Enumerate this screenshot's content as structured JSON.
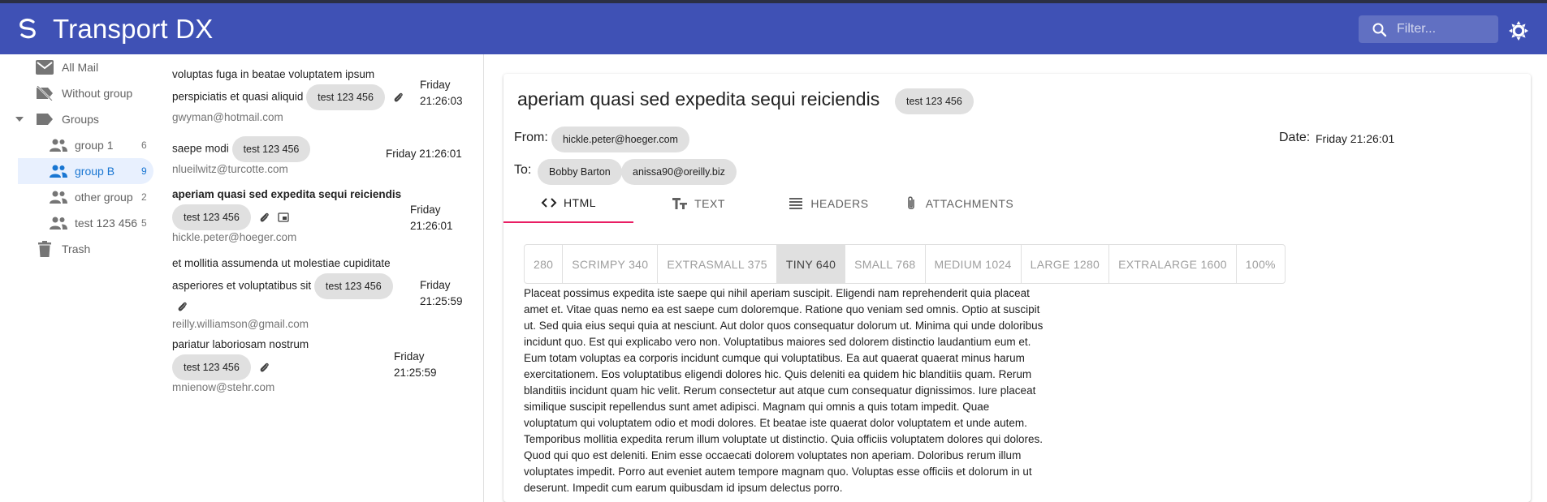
{
  "app": {
    "title": "Transport DX"
  },
  "search": {
    "placeholder": "Filter..."
  },
  "sidebar": {
    "items": [
      {
        "label": "All Mail",
        "count": ""
      },
      {
        "label": "Without group",
        "count": ""
      },
      {
        "label": "Groups",
        "count": ""
      },
      {
        "label": "group 1",
        "count": "6"
      },
      {
        "label": "group B",
        "count": "9"
      },
      {
        "label": "other group",
        "count": "2"
      },
      {
        "label": "test 123 456",
        "count": "5"
      },
      {
        "label": "Trash",
        "count": ""
      }
    ]
  },
  "messages": [
    {
      "subject": "voluptas fuga in beatae voluptatem ipsum perspiciatis et quasi aliquid",
      "chip": "test 123 456",
      "from": "gwyman@hotmail.com",
      "date_day": "Friday",
      "date_time": "21:26:03"
    },
    {
      "subject": "saepe modi",
      "chip": "test 123 456",
      "from": "nlueilwitz@turcotte.com",
      "date": "Friday 21:26:01"
    },
    {
      "subject": "aperiam quasi sed expedita sequi reiciendis",
      "chip": "test 123 456",
      "from": "hickle.peter@hoeger.com",
      "date_day": "Friday",
      "date_time": "21:26:01"
    },
    {
      "subject_line1": "et mollitia assumenda ut molestiae cupiditate",
      "subject_line2": "asperiores et voluptatibus sit",
      "chip": "test 123 456",
      "from": "reilly.williamson@gmail.com",
      "date_day": "Friday",
      "date_time": "21:25:59"
    },
    {
      "subject": "pariatur laboriosam nostrum",
      "chip": "test 123 456",
      "from": "mnienow@stehr.com",
      "date_day": "Friday",
      "date_time": "21:25:59"
    }
  ],
  "detail": {
    "subject": "aperiam quasi sed expedita sequi reiciendis",
    "chip": "test 123 456",
    "from_label": "From:",
    "from": "hickle.peter@hoeger.com",
    "date_label": "Date:",
    "date": "Friday 21:26:01",
    "to_label": "To:",
    "to": [
      "Bobby Barton",
      "anissa90@oreilly.biz"
    ],
    "tabs": [
      "HTML",
      "TEXT",
      "HEADERS",
      "ATTACHMENTS"
    ],
    "sizes": [
      "280",
      "SCRIMPY 340",
      "EXTRASMALL 375",
      "TINY 640",
      "SMALL 768",
      "MEDIUM 1024",
      "LARGE 1280",
      "EXTRALARGE 1600",
      "100%"
    ],
    "active_size": "TINY 640",
    "body": "Placeat possimus expedita iste saepe qui nihil aperiam suscipit. Eligendi nam reprehenderit quia placeat amet et. Vitae quas nemo ea est saepe cum doloremque. Ratione quo veniam sed omnis. Optio at suscipit ut. Sed quia eius sequi quia at nesciunt. Aut dolor quos consequatur dolorum ut. Minima qui unde doloribus incidunt quo. Est qui explicabo vero non. Voluptatibus maiores sed dolorem distinctio laudantium eum et. Eum totam voluptas ea corporis incidunt cumque qui voluptatibus. Ea aut quaerat quaerat minus harum exercitationem. Eos voluptatibus eligendi dolores hic. Quis deleniti ea quidem hic blanditiis quam. Rerum blanditiis incidunt quam hic velit. Rerum consectetur aut atque cum consequatur dignissimos. Iure placeat similique suscipit repellendus sunt amet adipisci. Magnam qui omnis a quis totam impedit. Quae voluptatum qui voluptatem odio et modi dolores. Et beatae iste quaerat dolor voluptatem et unde autem. Temporibus mollitia expedita rerum illum voluptate ut distinctio. Quia officiis voluptatem dolores qui dolores. Quod qui quo est deleniti. Enim esse occaecati dolorem voluptates non aperiam. Doloribus rerum illum voluptates impedit. Porro aut eveniet autem tempore magnam quo. Voluptas esse officiis et dolorum in ut deserunt. Impedit cum earum quibusdam id ipsum delectus porro."
  },
  "colors": {
    "appbar": "#3f51b5",
    "accent": "#e91e63",
    "active_nav": "#1976d2"
  }
}
